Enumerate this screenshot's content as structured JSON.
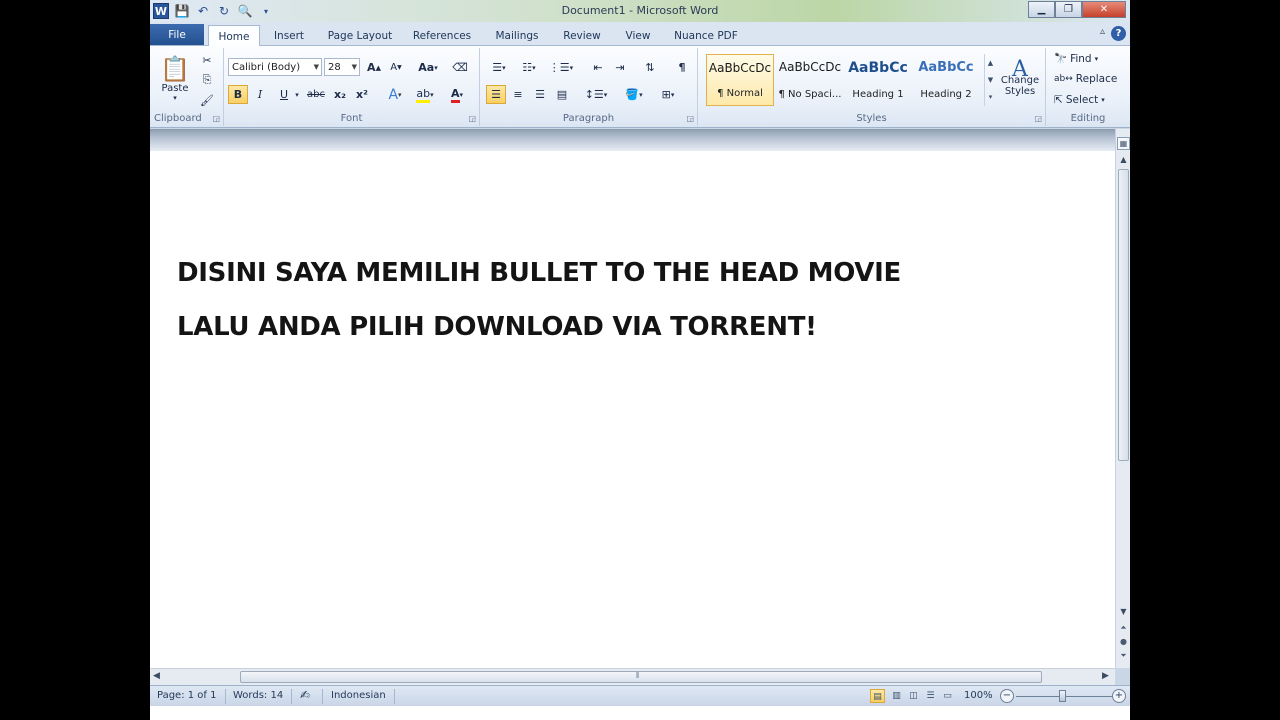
{
  "window": {
    "title": "Document1  -  Microsoft Word",
    "app_letter": "W"
  },
  "tabs": {
    "file": "File",
    "items": [
      "Home",
      "Insert",
      "Page Layout",
      "References",
      "Mailings",
      "Review",
      "View",
      "Nuance PDF"
    ],
    "active": "Home"
  },
  "ribbon": {
    "clipboard": {
      "label": "Clipboard",
      "paste": "Paste"
    },
    "font": {
      "label": "Font",
      "family": "Calibri (Body)",
      "size": "28",
      "case_btn": "Aa",
      "bold": "B",
      "italic": "I",
      "underline": "U",
      "strike": "abc",
      "sub": "x₂",
      "sup": "x²",
      "color_a": "A"
    },
    "paragraph": {
      "label": "Paragraph",
      "pilcrow": "¶"
    },
    "styles": {
      "label": "Styles",
      "items": [
        {
          "preview": "AaBbCcDc",
          "name": "¶ Normal"
        },
        {
          "preview": "AaBbCcDc",
          "name": "¶ No Spaci..."
        },
        {
          "preview": "AaBbCc",
          "name": "Heading 1"
        },
        {
          "preview": "AaBbCc",
          "name": "Heading 2"
        }
      ],
      "change": "Change Styles"
    },
    "editing": {
      "label": "Editing",
      "find": "Find",
      "replace": "Replace",
      "select": "Select"
    }
  },
  "document": {
    "lines": [
      "DISINI SAYA MEMILIH BULLET TO THE HEAD MOVIE",
      "LALU ANDA PILIH DOWNLOAD VIA TORRENT!"
    ]
  },
  "status": {
    "page": "Page: 1 of 1",
    "words": "Words: 14",
    "language": "Indonesian",
    "zoom": "100%",
    "zoom_minus": "−",
    "zoom_plus": "+"
  },
  "colors": {
    "accent": "#2b579a",
    "selected": "#f8cf62"
  }
}
